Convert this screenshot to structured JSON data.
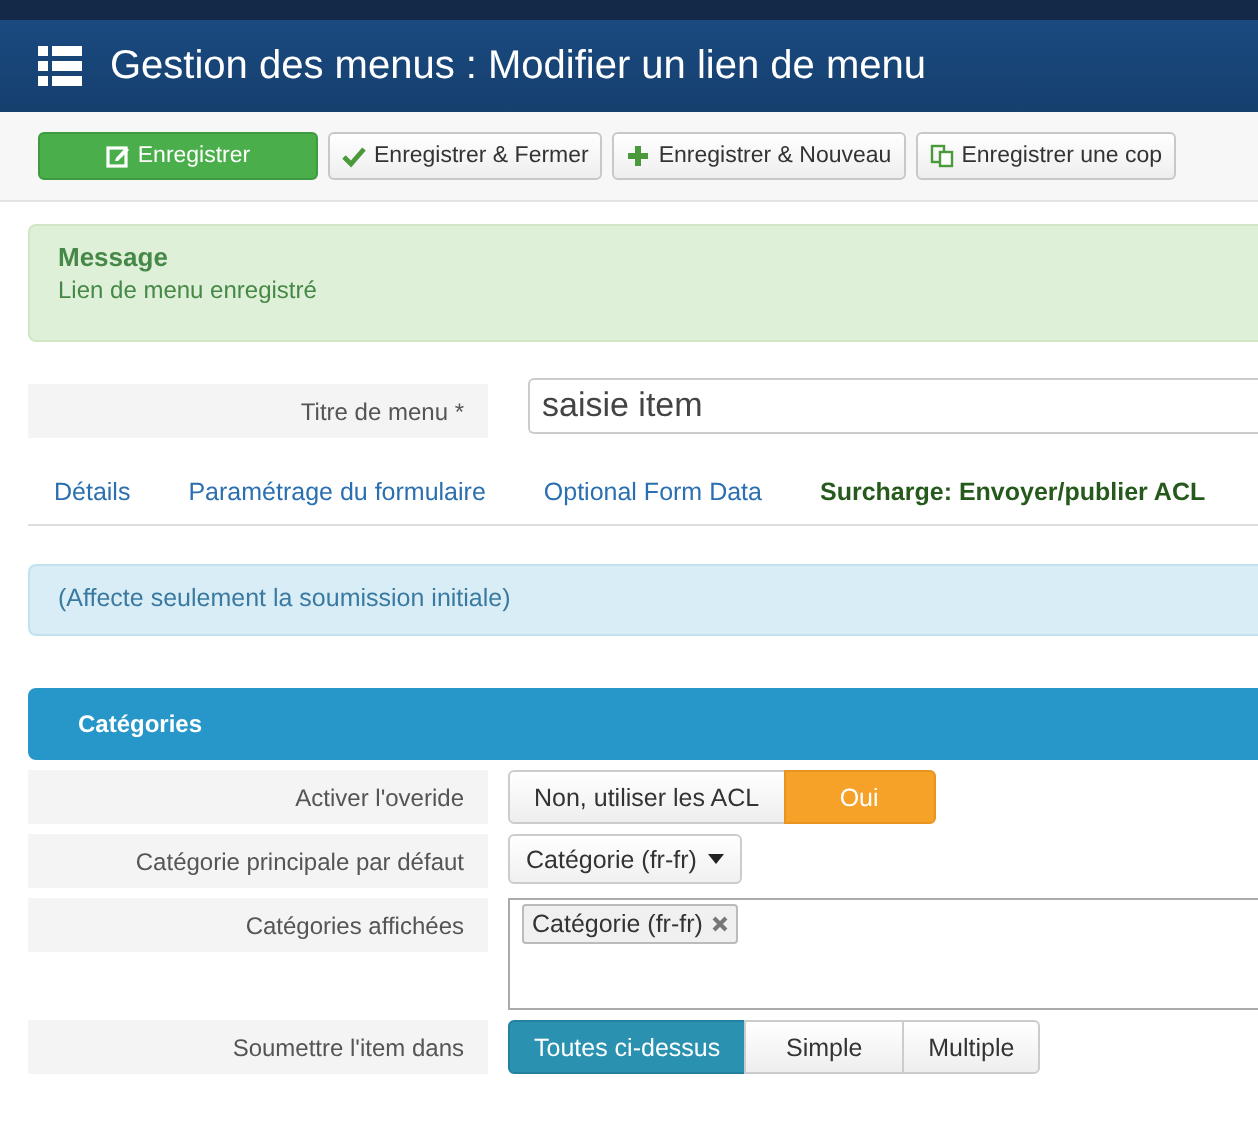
{
  "header": {
    "title": "Gestion des menus : Modifier un lien de menu"
  },
  "toolbar": [
    {
      "label": "Enregistrer",
      "kind": "save"
    },
    {
      "label": "Enregistrer & Fermer",
      "kind": "close"
    },
    {
      "label": "Enregistrer & Nouveau",
      "kind": "new"
    },
    {
      "label": "Enregistrer une cop",
      "kind": "copy"
    }
  ],
  "message": {
    "heading": "Message",
    "text": "Lien de menu enregistré"
  },
  "title_field": {
    "label": "Titre de menu *",
    "value": "saisie item"
  },
  "tabs": [
    {
      "label": "Détails",
      "selected": false
    },
    {
      "label": "Paramétrage du formulaire",
      "selected": false
    },
    {
      "label": "Optional Form Data",
      "selected": false
    },
    {
      "label": "Surcharge: Envoyer/publier ACL",
      "selected": true
    }
  ],
  "info": "(Affecte seulement la soumission initiale)",
  "section": {
    "title": "Catégories"
  },
  "fields": [
    {
      "kind": "toggle",
      "label": "Activer l'overide",
      "options": [
        {
          "label": "Non, utiliser les ACL",
          "selected": false
        },
        {
          "label": "Oui",
          "selected": true
        }
      ]
    },
    {
      "kind": "dropdown",
      "label": "Catégorie principale par défaut",
      "value": "Catégorie (fr-fr)"
    },
    {
      "kind": "tags",
      "label": "Catégories affichées",
      "tags": [
        "Catégorie (fr-fr)"
      ]
    },
    {
      "kind": "segmented",
      "label": "Soumettre l'item dans",
      "options": [
        {
          "label": "Toutes ci-dessus",
          "selected": true
        },
        {
          "label": "Simple",
          "selected": false
        },
        {
          "label": "Multiple",
          "selected": false
        }
      ]
    }
  ]
}
